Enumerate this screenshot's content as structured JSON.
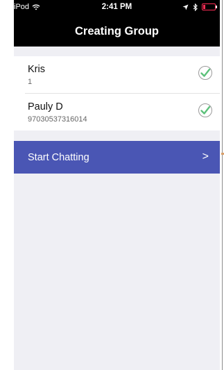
{
  "status_bar": {
    "device": "iPod",
    "time": "2:41 PM"
  },
  "header": {
    "title": "Creating Group"
  },
  "contacts": [
    {
      "name": "Kris",
      "detail": "1"
    },
    {
      "name": "Pauly D",
      "detail": "97030537316014"
    }
  ],
  "cta": {
    "label": "Start Chatting",
    "chevron": ">"
  },
  "colors": {
    "cta_background": "#4a56b4",
    "check_green": "#5cc17a",
    "battery_red": "#ff2d55"
  }
}
